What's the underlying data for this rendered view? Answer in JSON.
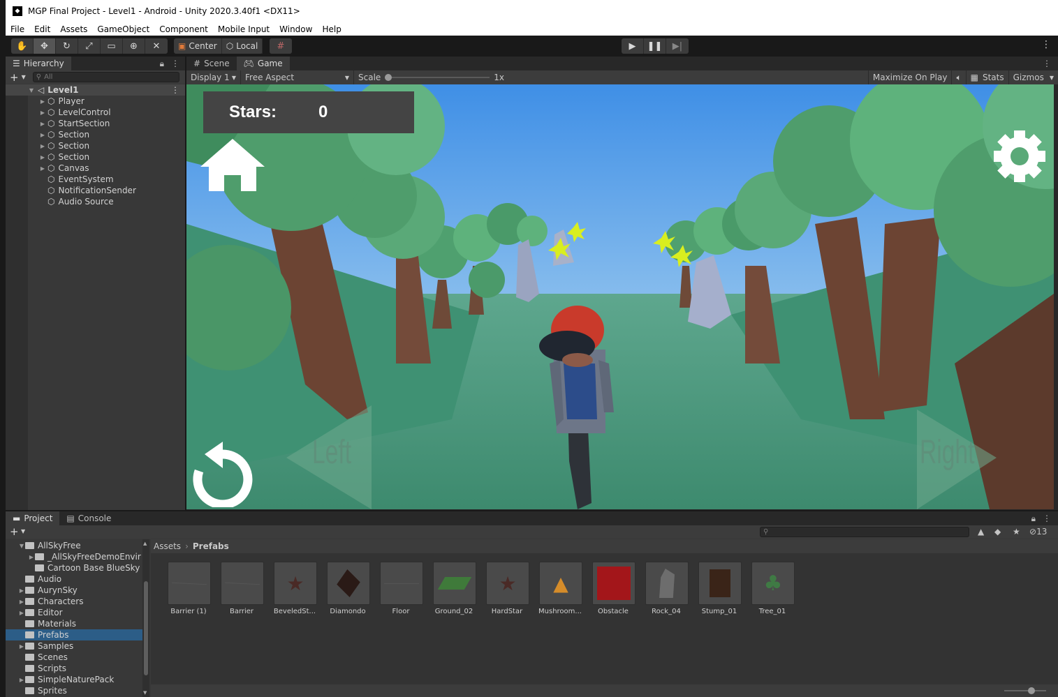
{
  "window": {
    "title": "MGP Final Project - Level1 - Android - Unity 2020.3.40f1 <DX11>"
  },
  "menu": [
    "File",
    "Edit",
    "Assets",
    "GameObject",
    "Component",
    "Mobile Input",
    "Window",
    "Help"
  ],
  "toolbar": {
    "pivot_label": "Center",
    "space_label": "Local"
  },
  "hierarchy": {
    "tab_label": "Hierarchy",
    "search_placeholder": "All",
    "scene_name": "Level1",
    "items": [
      {
        "label": "Player",
        "expandable": true
      },
      {
        "label": "LevelControl",
        "expandable": true
      },
      {
        "label": "StartSection",
        "expandable": true
      },
      {
        "label": "Section",
        "expandable": true
      },
      {
        "label": "Section",
        "expandable": true
      },
      {
        "label": "Section",
        "expandable": true
      },
      {
        "label": "Canvas",
        "expandable": true
      },
      {
        "label": "EventSystem",
        "expandable": false
      },
      {
        "label": "NotificationSender",
        "expandable": false
      },
      {
        "label": "Audio Source",
        "expandable": false
      }
    ]
  },
  "game": {
    "tabs": [
      "Scene",
      "Game"
    ],
    "display": "Display 1",
    "aspect": "Free Aspect",
    "scale_label": "Scale",
    "scale_value": "1x",
    "maximize": "Maximize On Play",
    "stats": "Stats",
    "gizmos": "Gizmos",
    "hud": {
      "stars_label": "Stars:",
      "stars_value": "0",
      "left_label": "Left",
      "right_label": "Right"
    }
  },
  "project": {
    "tabs": [
      "Project",
      "Console"
    ],
    "hidden_count": "13",
    "breadcrumb": [
      "Assets",
      "Prefabs"
    ],
    "folders": [
      {
        "label": "AllSkyFree",
        "indent": 1,
        "expanded": true,
        "arrow": true
      },
      {
        "label": "_AllSkyFreeDemoEnvir",
        "indent": 2,
        "arrow": true
      },
      {
        "label": "Cartoon Base BlueSky",
        "indent": 2,
        "arrow": false
      },
      {
        "label": "Audio",
        "indent": 1,
        "arrow": false
      },
      {
        "label": "AurynSky",
        "indent": 1,
        "arrow": true
      },
      {
        "label": "Characters",
        "indent": 1,
        "arrow": true
      },
      {
        "label": "Editor",
        "indent": 1,
        "arrow": true
      },
      {
        "label": "Materials",
        "indent": 1,
        "arrow": false
      },
      {
        "label": "Prefabs",
        "indent": 1,
        "arrow": false,
        "selected": true
      },
      {
        "label": "Samples",
        "indent": 1,
        "arrow": true
      },
      {
        "label": "Scenes",
        "indent": 1,
        "arrow": false
      },
      {
        "label": "Scripts",
        "indent": 1,
        "arrow": false
      },
      {
        "label": "SimpleNaturePack",
        "indent": 1,
        "arrow": true
      },
      {
        "label": "Sprites",
        "indent": 1,
        "arrow": false
      }
    ],
    "assets": [
      {
        "label": "Barrier (1)",
        "icon": "barrier-icon"
      },
      {
        "label": "Barrier",
        "icon": "barrier-icon"
      },
      {
        "label": "BeveledSt...",
        "icon": "star-icon"
      },
      {
        "label": "Diamondo",
        "icon": "diamond-icon"
      },
      {
        "label": "Floor",
        "icon": "floor-icon"
      },
      {
        "label": "Ground_02",
        "icon": "ground-icon"
      },
      {
        "label": "HardStar",
        "icon": "star-icon"
      },
      {
        "label": "Mushroom...",
        "icon": "mushroom-icon"
      },
      {
        "label": "Obstacle",
        "icon": "cube-icon"
      },
      {
        "label": "Rock_04",
        "icon": "rock-icon"
      },
      {
        "label": "Stump_01",
        "icon": "stump-icon"
      },
      {
        "label": "Tree_01",
        "icon": "tree-icon"
      }
    ]
  }
}
